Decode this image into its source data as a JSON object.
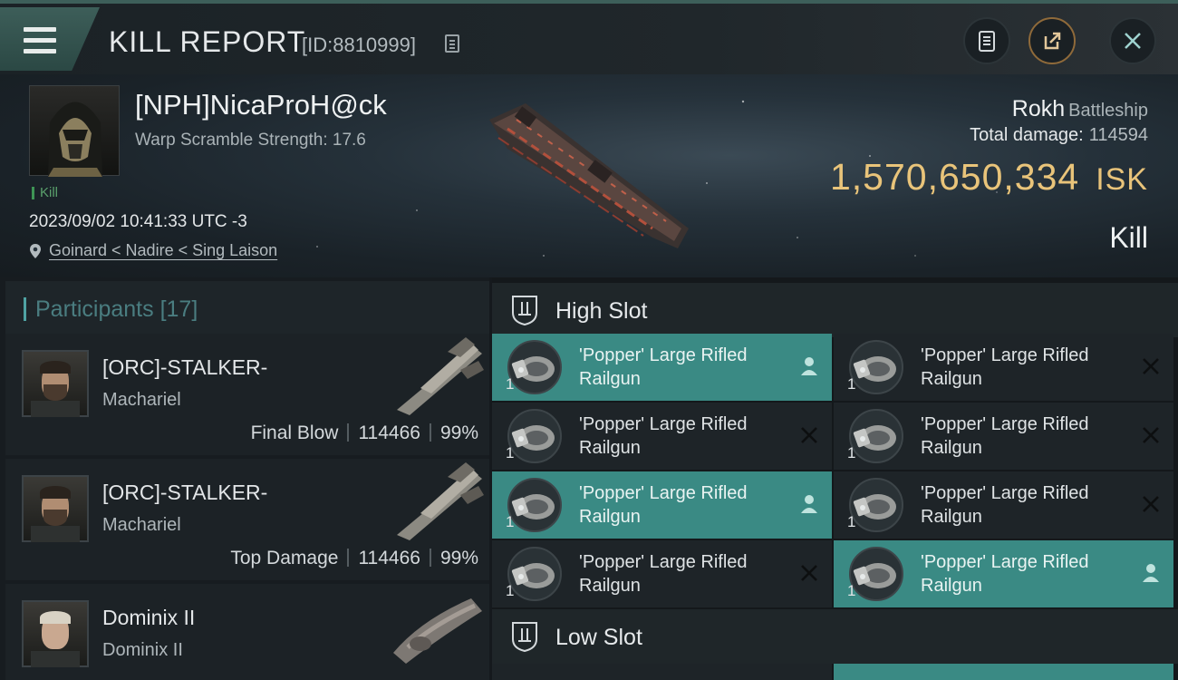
{
  "topbar": {
    "title": "KILL REPORT",
    "report_id": "[ID:8810999]"
  },
  "victim": {
    "name": "[NPH]NicaProH@ck",
    "warp_scramble": "Warp Scramble Strength: 17.6",
    "tag": "Kill",
    "datetime": "2023/09/02 10:41:33 UTC -3",
    "location": "Goinard < Nadire < Sing Laison"
  },
  "ship": {
    "name": "Rokh",
    "class": "Battleship",
    "total_damage_label": "Total damage:",
    "total_damage": "114594",
    "isk_value": "1,570,650,334",
    "isk_unit": "ISK",
    "result": "Kill"
  },
  "participants": {
    "label": "Participants",
    "count": "[17]",
    "rows": [
      {
        "name": "[ORC]-STALKER-",
        "ship": "Machariel",
        "role": "Final Blow",
        "damage": "114466",
        "percent": "99%"
      },
      {
        "name": "[ORC]-STALKER-",
        "ship": "Machariel",
        "role": "Top Damage",
        "damage": "114466",
        "percent": "99%"
      },
      {
        "name": "Dominix II",
        "ship": "Dominix II",
        "role": "",
        "damage": "",
        "percent": ""
      }
    ]
  },
  "slots": {
    "high": {
      "label": "High Slot",
      "modules": [
        {
          "name": "'Popper' Large Rifled Railgun",
          "qty": "1",
          "state": "dropped"
        },
        {
          "name": "'Popper' Large Rifled Railgun",
          "qty": "1",
          "state": "destroyed"
        },
        {
          "name": "'Popper' Large Rifled Railgun",
          "qty": "1",
          "state": "destroyed"
        },
        {
          "name": "'Popper' Large Rifled Railgun",
          "qty": "1",
          "state": "destroyed"
        },
        {
          "name": "'Popper' Large Rifled Railgun",
          "qty": "1",
          "state": "dropped"
        },
        {
          "name": "'Popper' Large Rifled Railgun",
          "qty": "1",
          "state": "destroyed"
        },
        {
          "name": "'Popper' Large Rifled Railgun",
          "qty": "1",
          "state": "destroyed"
        },
        {
          "name": "'Popper' Large Rifled Railgun",
          "qty": "1",
          "state": "dropped"
        }
      ]
    },
    "low": {
      "label": "Low Slot"
    }
  },
  "colors": {
    "accent_teal": "#3a8a84",
    "isk_gold": "#e9c47a",
    "kill_green": "#5aa06c"
  },
  "icons": {
    "menu": "hamburger-menu-icon",
    "copy": "copy-icon",
    "clipboard": "clipboard-icon",
    "share": "share-icon",
    "close": "close-icon",
    "location": "location-pin-icon",
    "slot": "high-slot-icon",
    "dropped": "person-icon",
    "destroyed": "x-icon"
  }
}
